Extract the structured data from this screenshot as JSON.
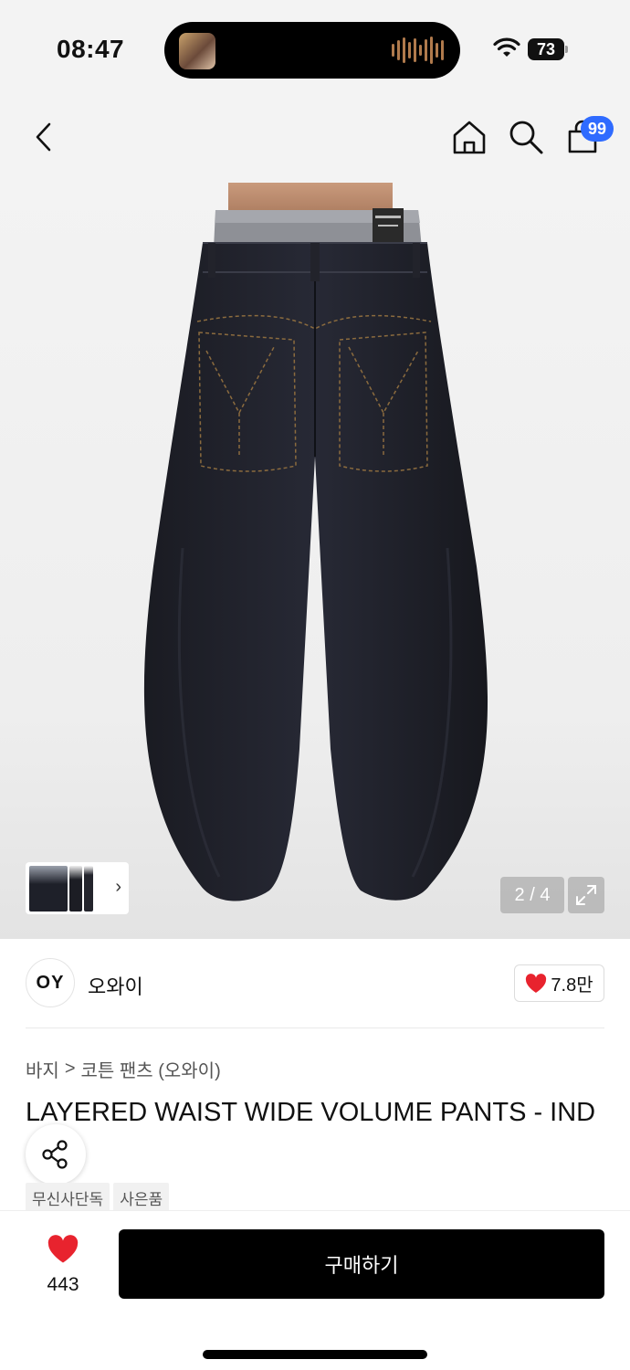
{
  "status_bar": {
    "time": "08:47",
    "battery": "73"
  },
  "header": {
    "cart_badge": "99"
  },
  "gallery": {
    "counter": "2 / 4"
  },
  "brand": {
    "logo_text": "OY",
    "name": "오와이",
    "likes": "7.8만"
  },
  "breadcrumb": {
    "category": "바지",
    "separator": ">",
    "sub": "코튼 팬츠 (오와이)"
  },
  "product": {
    "title": "LAYERED WAIST WIDE VOLUME PANTS - IND",
    "tags": [
      "무신사단독",
      "사은품"
    ]
  },
  "bottom_bar": {
    "wish_count": "443",
    "buy_label": "구매하기"
  },
  "colors": {
    "accent_blue": "#2f6bff",
    "heart_red": "#e8232e",
    "buy_black": "#000000"
  }
}
